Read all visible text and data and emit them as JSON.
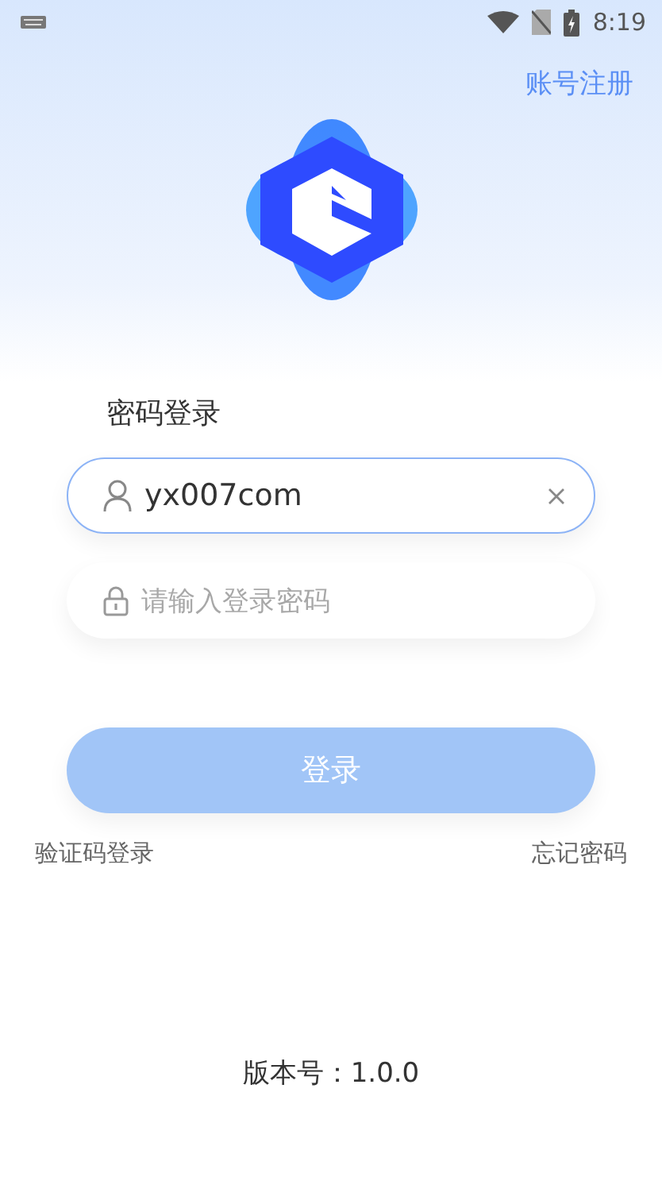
{
  "status_bar": {
    "time": "8:19"
  },
  "header": {
    "register_link": "账号注册"
  },
  "form": {
    "title": "密码登录",
    "username": {
      "value": "yx007com"
    },
    "password": {
      "placeholder": "请输入登录密码"
    },
    "login_button": {
      "label": "登录",
      "disabled": true
    },
    "links": [
      "验证码登录",
      "忘记密码"
    ]
  },
  "footer": {
    "version": "版本号：1.0.0"
  }
}
